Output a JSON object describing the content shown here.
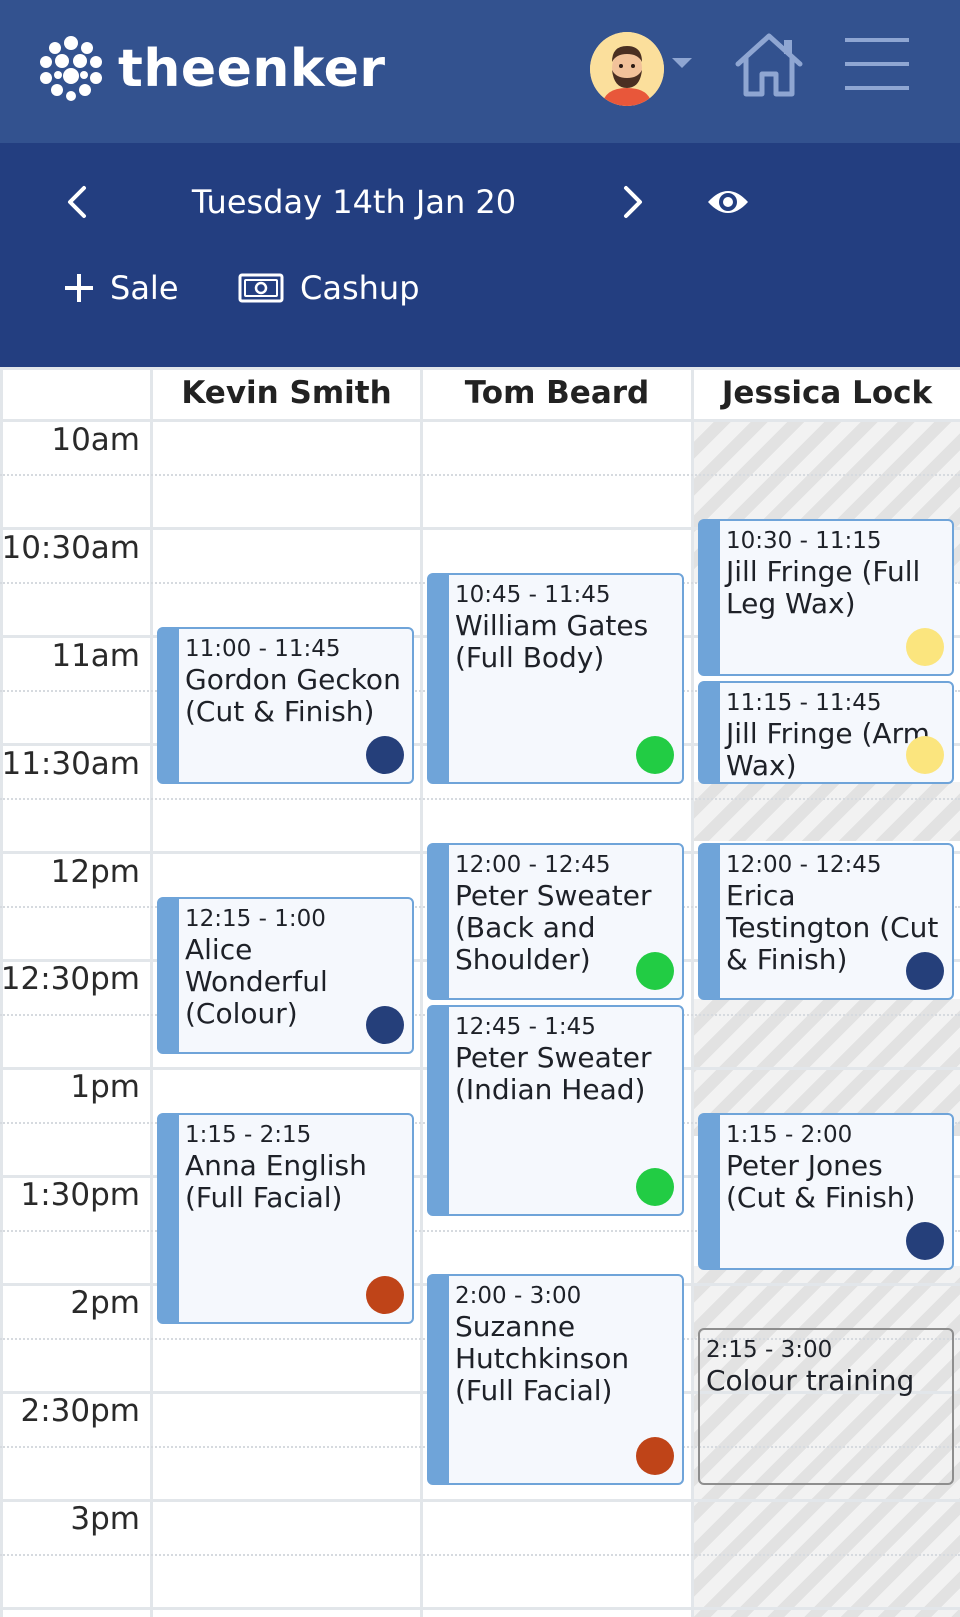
{
  "header": {
    "brand": "theenker",
    "date": "Tuesday 14th Jan 20",
    "sale_label": "Sale",
    "cashup_label": "Cashup"
  },
  "colors": {
    "header_bg": "#33528f",
    "datebar_bg": "#233e80",
    "appointment_bar": "#6fa4d9",
    "status_navy": "#253f7a",
    "status_green": "#22cc44",
    "status_yellow": "#fbe57e",
    "status_rust": "#bf4418"
  },
  "columns": [
    "Kevin Smith",
    "Tom Beard",
    "Jessica Lock"
  ],
  "time_slots": [
    "10am",
    "10:30am",
    "11am",
    "11:30am",
    "12pm",
    "12:30pm",
    "1pm",
    "1:30pm",
    "2pm",
    "2:30pm",
    "3pm"
  ],
  "appointments": [
    {
      "column": "Kevin Smith",
      "time": "11:00 - 11:45",
      "name": "Gordon Geckon (Cut & Finish)",
      "status": "navy"
    },
    {
      "column": "Kevin Smith",
      "time": "12:15 - 1:00",
      "name": "Alice Wonderful (Colour)",
      "status": "navy"
    },
    {
      "column": "Kevin Smith",
      "time": "1:15 - 2:15",
      "name": "Anna English (Full Facial)",
      "status": "rust"
    },
    {
      "column": "Tom Beard",
      "time": "10:45 - 11:45",
      "name": "William Gates (Full Body)",
      "status": "green"
    },
    {
      "column": "Tom Beard",
      "time": "12:00 - 12:45",
      "name": "Peter Sweater (Back and Shoulder)",
      "status": "green"
    },
    {
      "column": "Tom Beard",
      "time": "12:45 - 1:45",
      "name": "Peter Sweater (Indian Head)",
      "status": "green"
    },
    {
      "column": "Tom Beard",
      "time": "2:00 - 3:00",
      "name": "Suzanne Hutchkinson (Full Facial)",
      "status": "rust"
    },
    {
      "column": "Jessica Lock",
      "time": "10:30 - 11:15",
      "name": "Jill Fringe (Full Leg Wax)",
      "status": "yellow"
    },
    {
      "column": "Jessica Lock",
      "time": "11:15 - 11:45",
      "name": "Jill Fringe (Arm Wax)",
      "status": "yellow"
    },
    {
      "column": "Jessica Lock",
      "time": "12:00 - 12:45",
      "name": "Erica Testington (Cut & Finish)",
      "status": "navy"
    },
    {
      "column": "Jessica Lock",
      "time": "1:15 - 2:00",
      "name": "Peter Jones (Cut & Finish)",
      "status": "navy"
    },
    {
      "column": "Jessica Lock",
      "time": "2:15 - 3:00",
      "name": "Colour training",
      "status": "blocked"
    }
  ]
}
